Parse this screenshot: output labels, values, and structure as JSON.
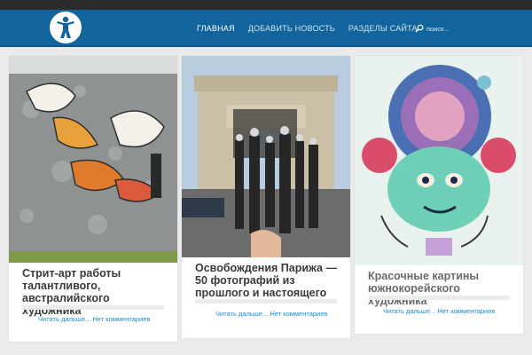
{
  "colors": {
    "topbar": "#2b2b2b",
    "header": "#11659c",
    "link": "#1a8ad0"
  },
  "header": {
    "logo_icon": "person-logo-icon",
    "nav": [
      {
        "label": "ГЛАВНАЯ",
        "active": true
      },
      {
        "label": "ДОБАВИТЬ НОВОСТЬ",
        "active": false
      },
      {
        "label": "РАЗДЕЛЫ САЙТА",
        "active": false
      }
    ],
    "search": {
      "icon": "search-icon",
      "placeholder": "поиск..."
    }
  },
  "posts": [
    {
      "title": "Стрит-арт работы талантливого, австралийского художника",
      "read_more": "Читать дальше...",
      "comments": "Нет комментариев",
      "image": "street-art-birds-mural"
    },
    {
      "title": "Освобождения Парижа — 50 фотографий из прошлого и настоящего",
      "read_more": "Читать дальше...",
      "comments": "Нет комментариев",
      "image": "arc-de-triomphe-then-and-now"
    },
    {
      "title": "Красочные картины южнокорейского художника",
      "read_more": "Читать дальше...",
      "comments": "Нет комментариев",
      "image": "colorful-korean-painting"
    }
  ]
}
